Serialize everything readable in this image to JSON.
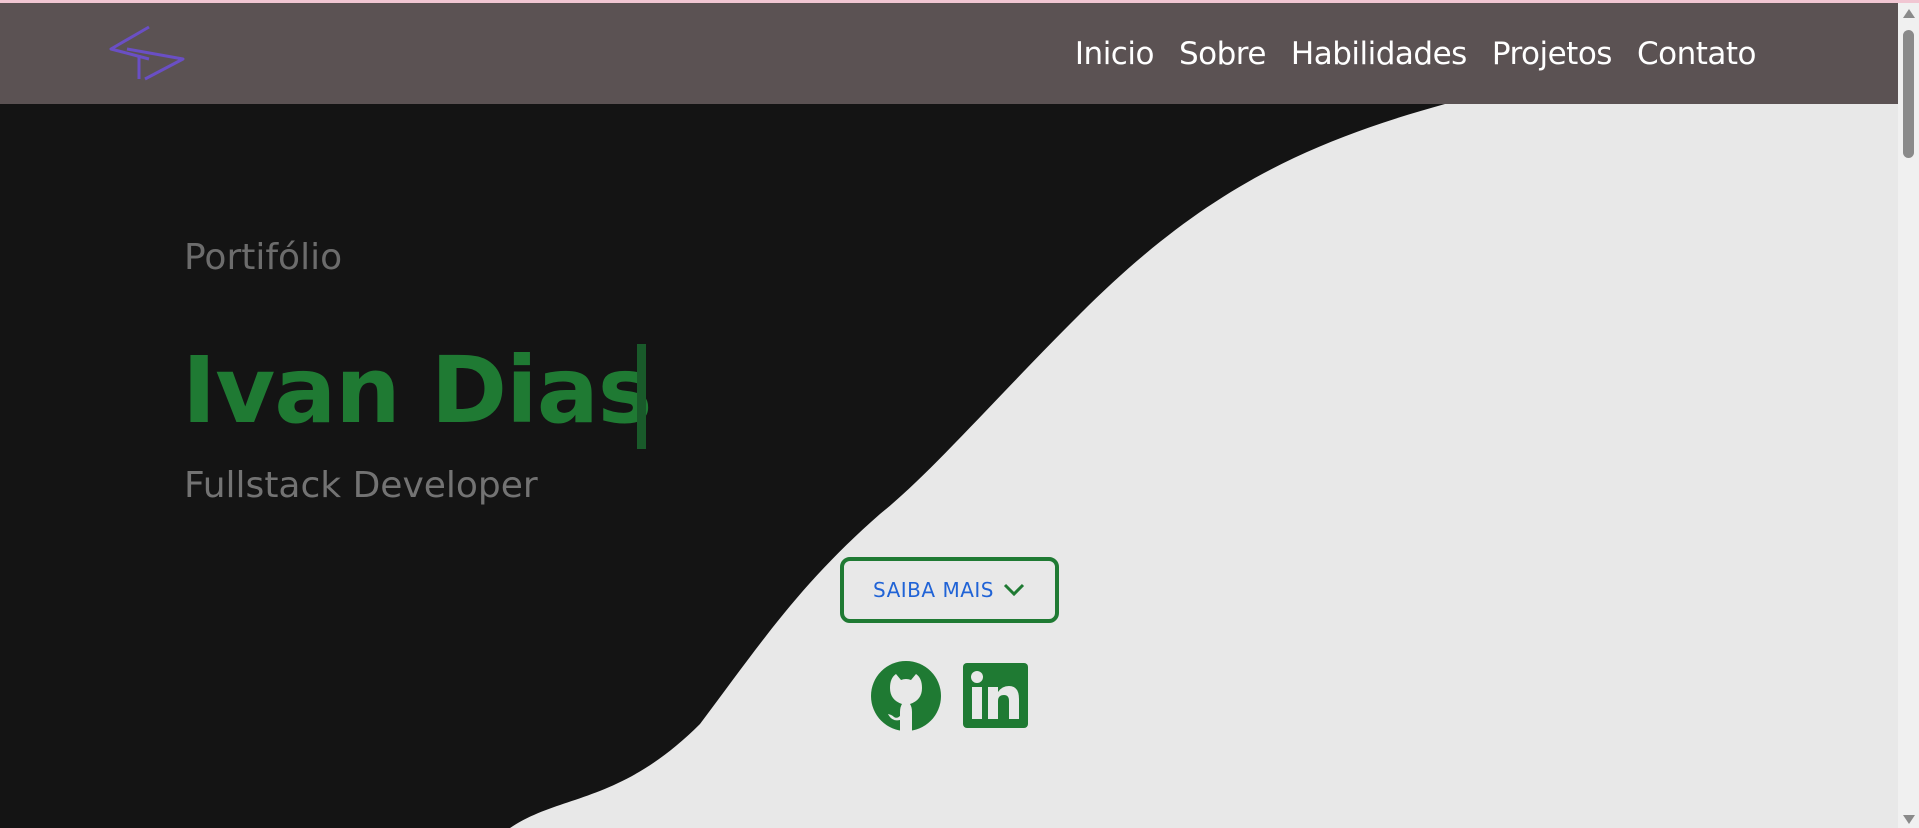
{
  "nav": {
    "links": [
      "Inicio",
      "Sobre",
      "Habilidades",
      "Projetos",
      "Contato"
    ]
  },
  "hero": {
    "eyebrow": "Portifólio",
    "name": "Ivan Dias",
    "role": "Fullstack Developer",
    "cta_label": "SAIBA MAIS"
  },
  "icons": {
    "logo": "code-brackets-logo",
    "cta": "chevron-down-icon",
    "social": [
      "github-icon",
      "linkedin-icon"
    ]
  },
  "colors": {
    "accent_green": "#1f7a33",
    "link_blue": "#2063d6",
    "navbar": "#5b5253",
    "logo_purple": "#6a4fc4"
  }
}
